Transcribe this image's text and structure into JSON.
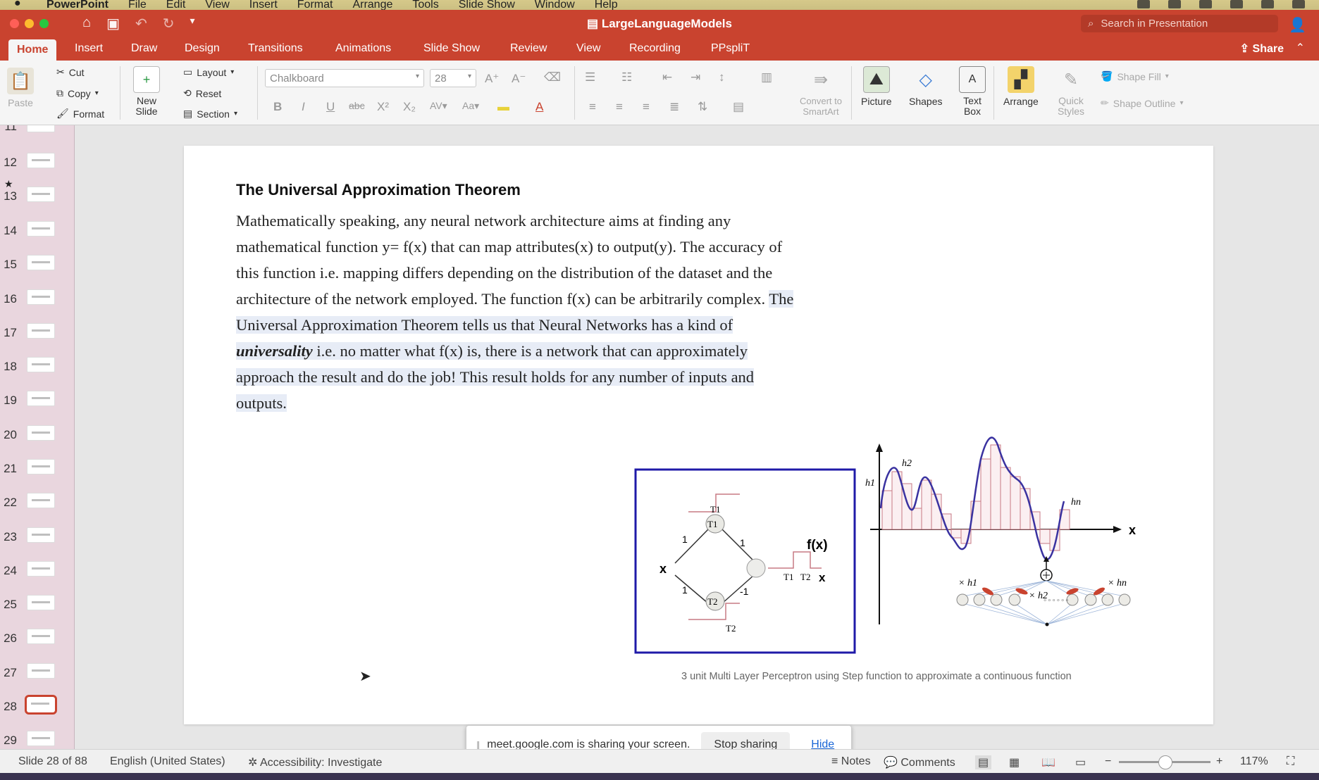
{
  "menubar": {
    "items": [
      "PowerPoint",
      "File",
      "Edit",
      "View",
      "Insert",
      "Format",
      "Arrange",
      "Tools",
      "Slide Show",
      "Window",
      "Help"
    ]
  },
  "window": {
    "title": "LargeLanguageModels",
    "search_placeholder": "Search in Presentation"
  },
  "tabs": [
    "Home",
    "Insert",
    "Draw",
    "Design",
    "Transitions",
    "Animations",
    "Slide Show",
    "Review",
    "View",
    "Recording",
    "PPspliT"
  ],
  "share_label": "Share",
  "ribbon": {
    "paste": "Paste",
    "cut": "Cut",
    "copy": "Copy",
    "format": "Format",
    "new_slide": "New Slide",
    "layout": "Layout",
    "reset": "Reset",
    "section": "Section",
    "font_name": "Chalkboard",
    "font_size": "28",
    "convert_smartart": "Convert to SmartArt",
    "picture": "Picture",
    "shapes": "Shapes",
    "text_box": "Text Box",
    "arrange": "Arrange",
    "quick_styles": "Quick Styles",
    "shape_fill": "Shape Fill",
    "shape_outline": "Shape Outline"
  },
  "thumbnails": [
    "11",
    "12",
    "13",
    "14",
    "15",
    "16",
    "17",
    "18",
    "19",
    "20",
    "21",
    "22",
    "23",
    "24",
    "25",
    "26",
    "27",
    "28",
    "29"
  ],
  "selected_slide": "28",
  "slide": {
    "title": "The Universal Approximation Theorem",
    "p1": "Mathematically speaking, any neural network architecture aims at finding any mathematical function y= f(x) that can map attributes(x) to output(y). The accuracy of this function i.e. mapping differs depending on the distribution of the dataset and the architecture of the network employed. The function f(x) can be arbitrarily complex.",
    "p2a": "The Universal Approximation Theorem tells us that Neural Networks has a kind of ",
    "p2_em": "universality",
    "p2b": " i.e. no matter what f(x) is, there is a network that can approximately approach the result and do the job! This result holds for any number of inputs and outputs.",
    "caption": "3 unit Multi Layer Perceptron using Step function to approximate a continuous function",
    "figure": {
      "input": "x",
      "nodes": [
        "T1",
        "T2"
      ],
      "weights": [
        "1",
        "1",
        "1",
        "-1"
      ],
      "output_label": "f(x)",
      "axis_x": "x",
      "heights": [
        "h1",
        "h2",
        "hn"
      ]
    }
  },
  "sharing": {
    "message": "meet.google.com is sharing your screen.",
    "stop": "Stop sharing",
    "hide": "Hide"
  },
  "status": {
    "slide_info": "Slide 28 of 88",
    "language": "English (United States)",
    "accessibility": "Accessibility: Investigate",
    "notes": "Notes",
    "comments": "Comments",
    "zoom": "117%"
  },
  "colors": {
    "accent": "#c9432f",
    "thumb_pane": "#e9d6de",
    "figure_box": "#1f1aa8",
    "curve": "#3a32a0",
    "bars": "#c77a84"
  }
}
